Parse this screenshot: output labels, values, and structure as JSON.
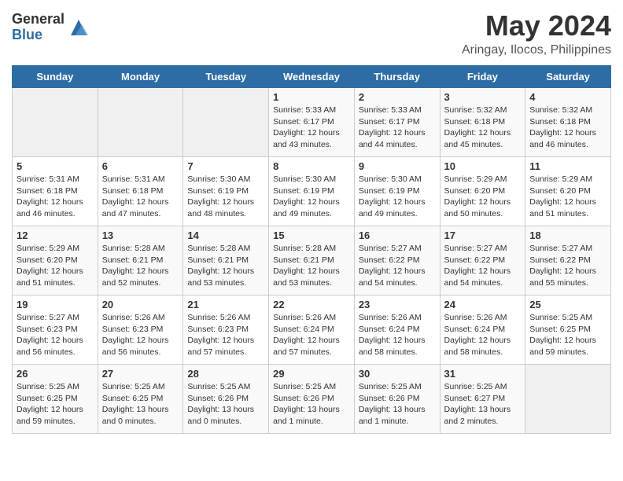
{
  "logo": {
    "general": "General",
    "blue": "Blue"
  },
  "title": {
    "month_year": "May 2024",
    "location": "Aringay, Ilocos, Philippines"
  },
  "weekdays": [
    "Sunday",
    "Monday",
    "Tuesday",
    "Wednesday",
    "Thursday",
    "Friday",
    "Saturday"
  ],
  "weeks": [
    [
      {
        "day": "",
        "info": ""
      },
      {
        "day": "",
        "info": ""
      },
      {
        "day": "",
        "info": ""
      },
      {
        "day": "1",
        "info": "Sunrise: 5:33 AM\nSunset: 6:17 PM\nDaylight: 12 hours\nand 43 minutes."
      },
      {
        "day": "2",
        "info": "Sunrise: 5:33 AM\nSunset: 6:17 PM\nDaylight: 12 hours\nand 44 minutes."
      },
      {
        "day": "3",
        "info": "Sunrise: 5:32 AM\nSunset: 6:18 PM\nDaylight: 12 hours\nand 45 minutes."
      },
      {
        "day": "4",
        "info": "Sunrise: 5:32 AM\nSunset: 6:18 PM\nDaylight: 12 hours\nand 46 minutes."
      }
    ],
    [
      {
        "day": "5",
        "info": "Sunrise: 5:31 AM\nSunset: 6:18 PM\nDaylight: 12 hours\nand 46 minutes."
      },
      {
        "day": "6",
        "info": "Sunrise: 5:31 AM\nSunset: 6:18 PM\nDaylight: 12 hours\nand 47 minutes."
      },
      {
        "day": "7",
        "info": "Sunrise: 5:30 AM\nSunset: 6:19 PM\nDaylight: 12 hours\nand 48 minutes."
      },
      {
        "day": "8",
        "info": "Sunrise: 5:30 AM\nSunset: 6:19 PM\nDaylight: 12 hours\nand 49 minutes."
      },
      {
        "day": "9",
        "info": "Sunrise: 5:30 AM\nSunset: 6:19 PM\nDaylight: 12 hours\nand 49 minutes."
      },
      {
        "day": "10",
        "info": "Sunrise: 5:29 AM\nSunset: 6:20 PM\nDaylight: 12 hours\nand 50 minutes."
      },
      {
        "day": "11",
        "info": "Sunrise: 5:29 AM\nSunset: 6:20 PM\nDaylight: 12 hours\nand 51 minutes."
      }
    ],
    [
      {
        "day": "12",
        "info": "Sunrise: 5:29 AM\nSunset: 6:20 PM\nDaylight: 12 hours\nand 51 minutes."
      },
      {
        "day": "13",
        "info": "Sunrise: 5:28 AM\nSunset: 6:21 PM\nDaylight: 12 hours\nand 52 minutes."
      },
      {
        "day": "14",
        "info": "Sunrise: 5:28 AM\nSunset: 6:21 PM\nDaylight: 12 hours\nand 53 minutes."
      },
      {
        "day": "15",
        "info": "Sunrise: 5:28 AM\nSunset: 6:21 PM\nDaylight: 12 hours\nand 53 minutes."
      },
      {
        "day": "16",
        "info": "Sunrise: 5:27 AM\nSunset: 6:22 PM\nDaylight: 12 hours\nand 54 minutes."
      },
      {
        "day": "17",
        "info": "Sunrise: 5:27 AM\nSunset: 6:22 PM\nDaylight: 12 hours\nand 54 minutes."
      },
      {
        "day": "18",
        "info": "Sunrise: 5:27 AM\nSunset: 6:22 PM\nDaylight: 12 hours\nand 55 minutes."
      }
    ],
    [
      {
        "day": "19",
        "info": "Sunrise: 5:27 AM\nSunset: 6:23 PM\nDaylight: 12 hours\nand 56 minutes."
      },
      {
        "day": "20",
        "info": "Sunrise: 5:26 AM\nSunset: 6:23 PM\nDaylight: 12 hours\nand 56 minutes."
      },
      {
        "day": "21",
        "info": "Sunrise: 5:26 AM\nSunset: 6:23 PM\nDaylight: 12 hours\nand 57 minutes."
      },
      {
        "day": "22",
        "info": "Sunrise: 5:26 AM\nSunset: 6:24 PM\nDaylight: 12 hours\nand 57 minutes."
      },
      {
        "day": "23",
        "info": "Sunrise: 5:26 AM\nSunset: 6:24 PM\nDaylight: 12 hours\nand 58 minutes."
      },
      {
        "day": "24",
        "info": "Sunrise: 5:26 AM\nSunset: 6:24 PM\nDaylight: 12 hours\nand 58 minutes."
      },
      {
        "day": "25",
        "info": "Sunrise: 5:25 AM\nSunset: 6:25 PM\nDaylight: 12 hours\nand 59 minutes."
      }
    ],
    [
      {
        "day": "26",
        "info": "Sunrise: 5:25 AM\nSunset: 6:25 PM\nDaylight: 12 hours\nand 59 minutes."
      },
      {
        "day": "27",
        "info": "Sunrise: 5:25 AM\nSunset: 6:25 PM\nDaylight: 13 hours\nand 0 minutes."
      },
      {
        "day": "28",
        "info": "Sunrise: 5:25 AM\nSunset: 6:26 PM\nDaylight: 13 hours\nand 0 minutes."
      },
      {
        "day": "29",
        "info": "Sunrise: 5:25 AM\nSunset: 6:26 PM\nDaylight: 13 hours\nand 1 minute."
      },
      {
        "day": "30",
        "info": "Sunrise: 5:25 AM\nSunset: 6:26 PM\nDaylight: 13 hours\nand 1 minute."
      },
      {
        "day": "31",
        "info": "Sunrise: 5:25 AM\nSunset: 6:27 PM\nDaylight: 13 hours\nand 2 minutes."
      },
      {
        "day": "",
        "info": ""
      }
    ]
  ]
}
